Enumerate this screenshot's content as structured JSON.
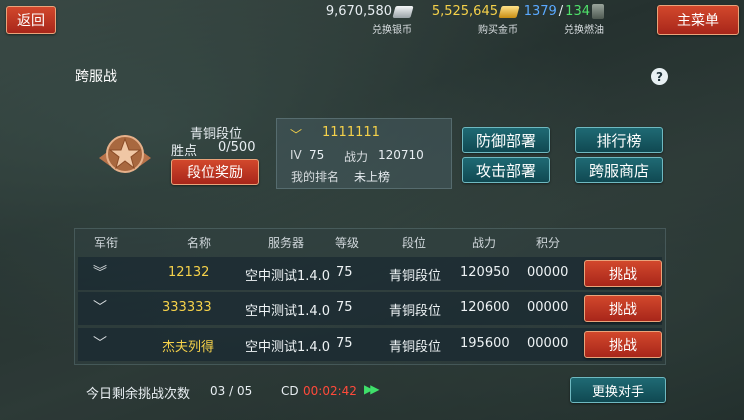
{
  "header": {
    "back_label": "返回",
    "main_menu_label": "主菜单",
    "silver": {
      "value": "9,670,580",
      "label": "兑换银币",
      "icon": "silver-bars-icon"
    },
    "gold": {
      "value": "5,525,645",
      "label": "购买金币",
      "icon": "gold-bars-icon"
    },
    "fuel": {
      "value_current": "1379",
      "value_max": "134",
      "label": "兑换燃油",
      "icon": "fuel-barrel-icon"
    }
  },
  "page": {
    "title": "跨服战",
    "help_icon": "?"
  },
  "rank": {
    "name": "青铜段位",
    "points_label": "胜点",
    "points_value": "0/500",
    "reward_button": "段位奖励",
    "emblem_icon": "bronze-star-emblem-icon"
  },
  "player": {
    "name": "1111111",
    "level_label": "IV",
    "level_value": "75",
    "power_label": "战力",
    "power_value": "120710",
    "myrank_label": "我的排名",
    "myrank_value": "未上榜"
  },
  "actions": {
    "defense": "防御部署",
    "attack": "攻击部署",
    "leaderboard": "排行榜",
    "shop": "跨服商店"
  },
  "table": {
    "headers": [
      "军衔",
      "名称",
      "服务器",
      "等级",
      "段位",
      "战力",
      "积分"
    ],
    "rows": [
      {
        "rank_icon": "double-chevron",
        "name": "12132",
        "server": "空中测试1.4.0",
        "level": "75",
        "tier": "青铜段位",
        "power": "120950",
        "score": "00000",
        "action": "挑战"
      },
      {
        "rank_icon": "single-chevron",
        "name": "333333",
        "server": "空中测试1.4.0",
        "level": "75",
        "tier": "青铜段位",
        "power": "120600",
        "score": "00000",
        "action": "挑战"
      },
      {
        "rank_icon": "single-chevron",
        "name": "杰夫列得",
        "server": "空中测试1.4.0",
        "level": "75",
        "tier": "青铜段位",
        "power": "195600",
        "score": "00000",
        "action": "挑战"
      }
    ]
  },
  "footer": {
    "attempts_label": "今日剩余挑战次数",
    "attempts_value": "03 / 05",
    "cd_label": "CD",
    "cd_value": "00:02:42",
    "change_opponent": "更换对手"
  },
  "colors": {
    "accent_red": "#c0392b",
    "teal": "#1a5d66",
    "gold_text": "#f6d24a",
    "cd_red": "#ff4a3a"
  }
}
